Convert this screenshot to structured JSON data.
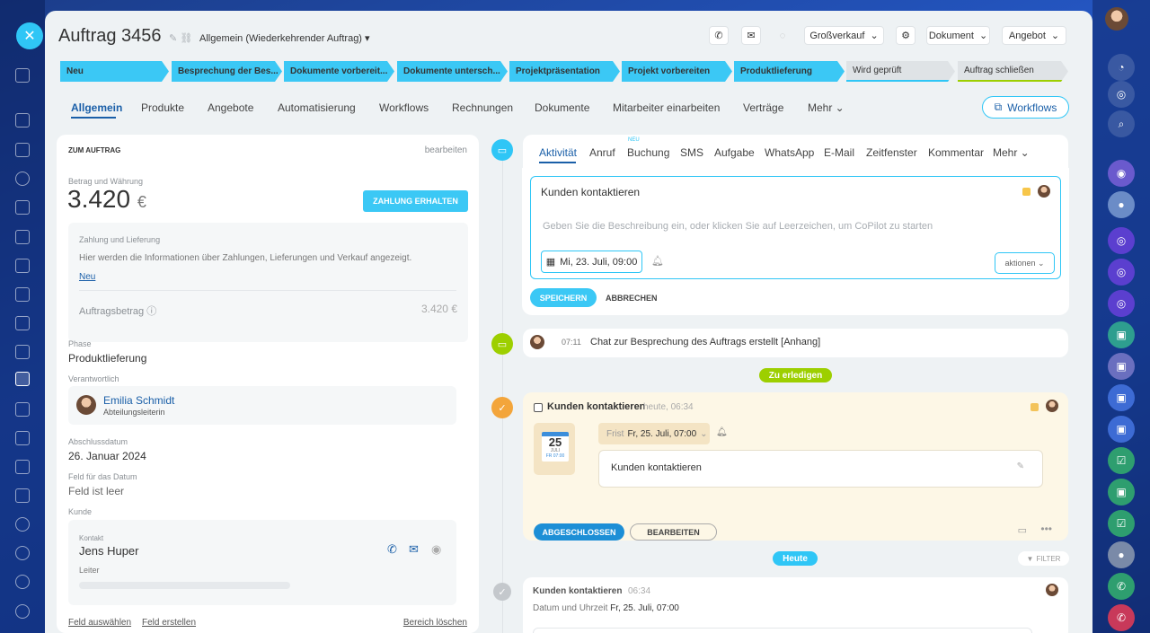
{
  "header": {
    "title": "Auftrag 3456",
    "subtitle": "Allgemein (Wiederkehrender Auftrag)",
    "grosskauf": "Großverkauf",
    "dokument": "Dokument",
    "angebot": "Angebot"
  },
  "stages": [
    "Neu",
    "Besprechung der Bes...",
    "Dokumente vorbereit...",
    "Dokumente untersch...",
    "Projektpräsentation",
    "Projekt vorbereiten",
    "Produktlieferung",
    "Wird geprüft",
    "Auftrag schließen"
  ],
  "tabs": [
    "Allgemein",
    "Produkte",
    "Angebote",
    "Automatisierung",
    "Workflows",
    "Rechnungen",
    "Dokumente",
    "Mitarbeiter einarbeiten",
    "Verträge",
    "Mehr"
  ],
  "workflows_btn": "Workflows",
  "left": {
    "section_title": "ZUM AUFTRAG",
    "edit": "bearbeiten",
    "amount_label": "Betrag und Währung",
    "amount": "3.420",
    "currency": "€",
    "pay_btn": "ZAHLUNG ERHALTEN",
    "payment_title": "Zahlung und Lieferung",
    "payment_text": "Hier werden die Informationen über Zahlungen, Lieferungen und Verkauf angezeigt.",
    "payment_new": "Neu",
    "order_amount_label": "Auftragsbetrag",
    "order_amount": "3.420 €",
    "phase_label": "Phase",
    "phase": "Produktlieferung",
    "resp_label": "Verantwortlich",
    "resp_name": "Emilia Schmidt",
    "resp_role": "Abteilungsleiterin",
    "close_label": "Abschlussdatum",
    "close_date": "26. Januar 2024",
    "datefield_label": "Feld für das Datum",
    "datefield_value": "Feld ist leer",
    "client_label": "Kunde",
    "contact_label": "Kontakt",
    "contact_name": "Jens Huper",
    "contact_role": "Leiter",
    "footer_select": "Feld auswählen",
    "footer_create": "Feld erstellen",
    "footer_clear": "Bereich löschen"
  },
  "activity_tabs": [
    "Aktivität",
    "Anruf",
    "Buchung",
    "SMS",
    "Aufgabe",
    "WhatsApp",
    "E-Mail",
    "Zeitfenster",
    "Kommentar",
    "Mehr"
  ],
  "neu_badge": "NEU",
  "editor": {
    "title": "Kunden kontaktieren",
    "placeholder": "Geben Sie die Beschreibung ein, oder klicken Sie auf Leerzeichen, um CoPilot zu starten",
    "date": "Mi, 23. Juli, 09:00",
    "actions": "aktionen",
    "save": "SPEICHERN",
    "cancel": "ABBRECHEN"
  },
  "chat_item": {
    "time": "07:11",
    "text": "Chat zur Besprechung des Auftrags erstellt [Anhang]"
  },
  "todo_pill": "Zu erledigen",
  "task": {
    "title": "Kunden kontaktieren",
    "time": "heute, 06:34",
    "deadline_label": "Frist",
    "deadline": "Fr, 25. Juli, 07:00",
    "cal_day": "25",
    "cal_month": "JULI",
    "cal_footer": "FR 07:00",
    "text": "Kunden kontaktieren",
    "done": "ABGESCHLOSSEN",
    "edit": "BEARBEITEN"
  },
  "today_pill": "Heute",
  "filter": "FILTER",
  "history": {
    "title": "Kunden kontaktieren",
    "time": "06:34",
    "date_label": "Datum und Uhrzeit",
    "date": "Fr, 25. Juli, 07:00"
  },
  "colors": {
    "accent": "#2fc6f6",
    "stage_done": "#3bc8f5",
    "stage_todo": "#dfe3e6",
    "todo": "#9dcf00",
    "today": "#2fc6f6"
  }
}
